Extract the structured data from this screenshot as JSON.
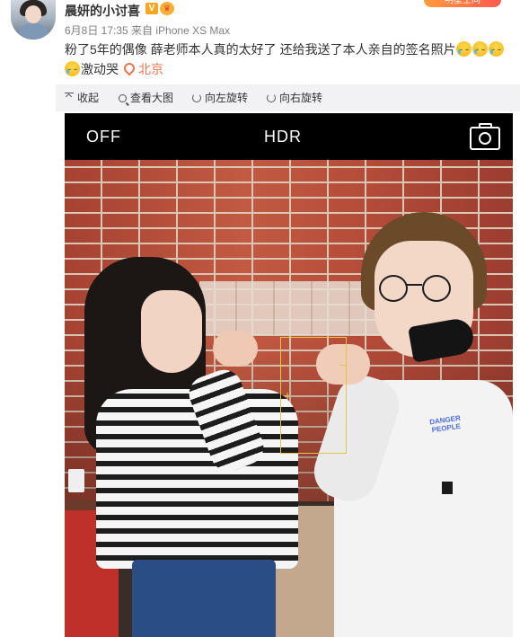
{
  "post": {
    "username": "晨妍的小讨喜",
    "vip_badge": "V",
    "crown": "♛",
    "follow_tag": "明星空间",
    "meta": "6月8日 17:35 来自 iPhone XS Max",
    "text": "粉了5年的偶像 薛老师本人真的太好了 还给我送了本人亲自的签名照片",
    "text_tail": "激动哭",
    "location": "北京",
    "emoji": "crying-emoji"
  },
  "toolbar": {
    "collapse": "收起",
    "view_large": "查看大图",
    "rotate_left": "向左旋转",
    "rotate_right": "向右旋转"
  },
  "camera": {
    "flash": "OFF",
    "hdr": "HDR",
    "shirt_text": "DANGER PEOPLE"
  },
  "colors": {
    "accent": "#eb7350",
    "toolbar_bg": "#f2f2f5",
    "focus": "#e5c44a"
  }
}
